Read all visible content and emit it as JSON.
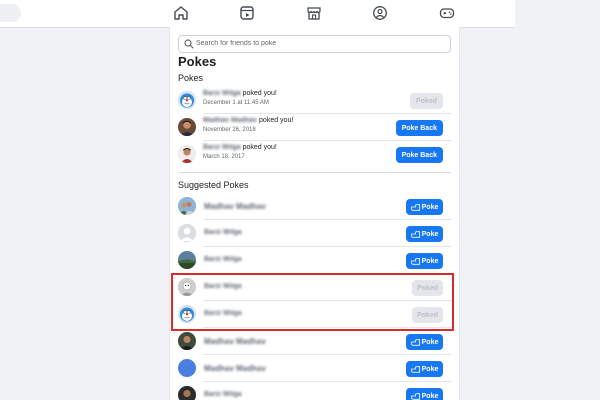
{
  "nav": {
    "icons": [
      "home-icon",
      "video-icon",
      "marketplace-icon",
      "groups-icon",
      "gaming-icon"
    ]
  },
  "search": {
    "placeholder": "Search for friends to poke"
  },
  "page": {
    "title": "Pokes",
    "pokes_heading": "Pokes",
    "suggested_heading": "Suggested Pokes"
  },
  "pokes": [
    {
      "name": "Barzi Wilga",
      "action": "poked you!",
      "date": "December 1 at 11:45 AM",
      "button": "Poked",
      "button_state": "disabled"
    },
    {
      "name": "Madhav Madhav",
      "action": "poked you!",
      "date": "November 26, 2018",
      "button": "Poke Back",
      "button_state": "active"
    },
    {
      "name": "Barzi Wilga",
      "action": "poked you!",
      "date": "March 18, 2017",
      "button": "Poke Back",
      "button_state": "active"
    }
  ],
  "suggested": [
    {
      "name": "Madhav Madhav",
      "button": "Poke",
      "button_state": "active"
    },
    {
      "name": "Barzi Wilga",
      "button": "Poke",
      "button_state": "active"
    },
    {
      "name": "Barzi Wilga",
      "button": "Poke",
      "button_state": "active"
    },
    {
      "name": "Barzi Wilga",
      "button": "Poked",
      "button_state": "disabled"
    },
    {
      "name": "Barzi Wilga",
      "button": "Poked",
      "button_state": "disabled"
    },
    {
      "name": "Madhav Madhav",
      "button": "Poke",
      "button_state": "active"
    },
    {
      "name": "Madhav Madhav",
      "button": "Poke",
      "button_state": "active"
    },
    {
      "name": "Barzi Wilga",
      "button": "Poke",
      "button_state": "active"
    }
  ],
  "colors": {
    "accent": "#1877f2",
    "highlight": "#d92b2b",
    "disabled": "#e4e6eb"
  }
}
